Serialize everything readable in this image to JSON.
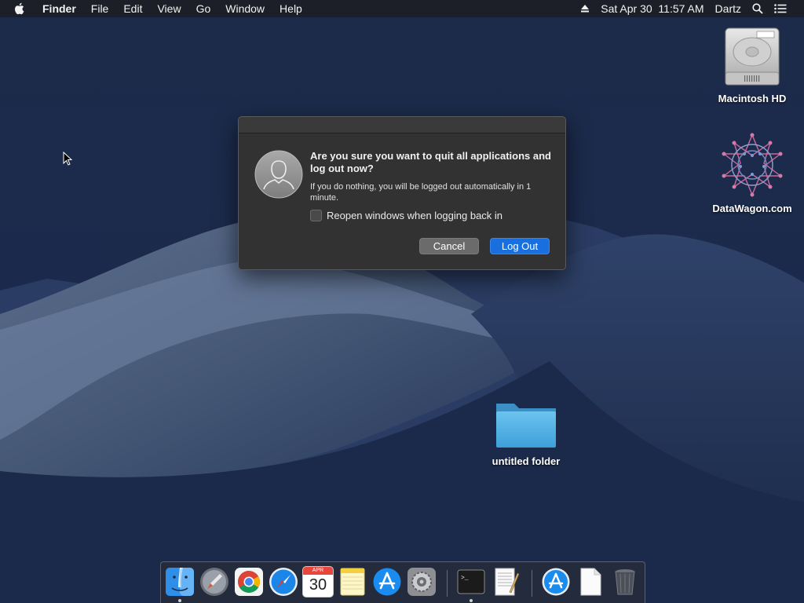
{
  "menubar": {
    "app_name": "Finder",
    "menus": [
      "File",
      "Edit",
      "View",
      "Go",
      "Window",
      "Help"
    ],
    "datetime": "Sat Apr 30  11:57 AM",
    "user": "Dartz"
  },
  "desktop": {
    "icons": [
      {
        "label": "Macintosh HD",
        "icon": "hard-drive-icon"
      },
      {
        "label": "DataWagon.com",
        "icon": "datawagon-logo-icon"
      },
      {
        "label": "untitled folder",
        "icon": "folder-icon"
      }
    ]
  },
  "dialog": {
    "headline": "Are you sure you want to quit all applications and log out now?",
    "subtext": "If you do nothing, you will be logged out automatically in 1 minute.",
    "checkbox_label": "Reopen windows when logging back in",
    "checkbox_checked": false,
    "cancel_label": "Cancel",
    "logout_label": "Log Out"
  },
  "dock": {
    "calendar_month": "APR",
    "calendar_day": "30",
    "items": [
      "finder",
      "launchpad",
      "chrome",
      "safari",
      "calendar",
      "notes",
      "app-store",
      "system-preferences",
      "terminal",
      "textedit",
      "app-store-downloads",
      "document",
      "trash"
    ]
  },
  "colors": {
    "accent": "#1a6fde",
    "dialog_bg": "#323232",
    "menubar_bg": "#1c1e24"
  }
}
